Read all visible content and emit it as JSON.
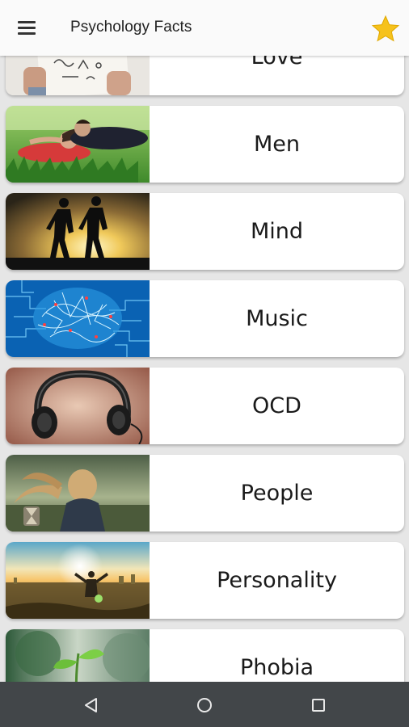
{
  "app_bar": {
    "title": "Psychology Facts",
    "menu_icon": "hamburger-menu-icon",
    "favorite_icon": "star-icon",
    "favorite_color": "#f6c21c"
  },
  "categories": [
    {
      "label": "Love",
      "thumbnail": "hands-holding-paper-image"
    },
    {
      "label": "Men",
      "thumbnail": "couple-lying-in-grass-image"
    },
    {
      "label": "Mind",
      "thumbnail": "runners-silhouette-sunset-image"
    },
    {
      "label": "Music",
      "thumbnail": "blue-brain-circuit-image"
    },
    {
      "label": "OCD",
      "thumbnail": "headphones-image"
    },
    {
      "label": "People",
      "thumbnail": "woman-hair-blowing-image"
    },
    {
      "label": "Personality",
      "thumbnail": "man-arms-raised-sunrise-image"
    },
    {
      "label": "Phobia",
      "thumbnail": "sprout-in-hand-image"
    }
  ],
  "nav_bar": {
    "back_icon": "back-triangle-icon",
    "home_icon": "home-circle-icon",
    "recents_icon": "recents-square-icon"
  }
}
